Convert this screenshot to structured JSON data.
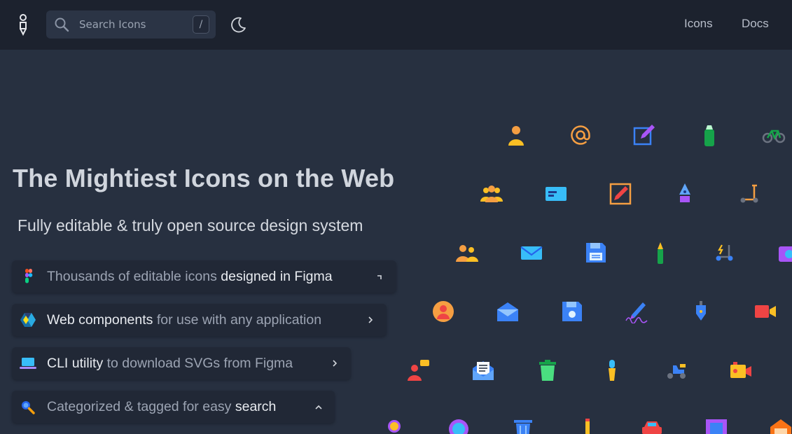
{
  "nav": {
    "search_placeholder": "Search Icons",
    "search_shortcut": "/",
    "links": [
      "Icons",
      "Docs"
    ]
  },
  "hero": {
    "title": "The Mightiest Icons on the Web",
    "subtitle": "Fully editable & truly open source design system"
  },
  "features": [
    {
      "icon": "figma-icon",
      "parts": [
        {
          "t": "Thousands of editable icons ",
          "hi": false
        },
        {
          "t": "designed in Figma",
          "hi": true
        }
      ],
      "chevron": "corner"
    },
    {
      "icon": "webcomponents-icon",
      "parts": [
        {
          "t": "Web components",
          "hi": true
        },
        {
          "t": " for use with any application",
          "hi": false
        }
      ],
      "chevron": "right"
    },
    {
      "icon": "laptop-icon",
      "parts": [
        {
          "t": "CLI utility",
          "hi": true
        },
        {
          "t": " to download SVGs from Figma",
          "hi": false
        }
      ],
      "chevron": "right"
    },
    {
      "icon": "search-icon",
      "parts": [
        {
          "t": "Categorized & tagged for easy ",
          "hi": false
        },
        {
          "t": "search",
          "hi": true
        }
      ],
      "chevron": "up"
    }
  ],
  "colors": {
    "background": "#273040",
    "navbar": "#1c222e",
    "pill": "#212836",
    "accent_blue": "#3b82f6",
    "accent_orange": "#f59e42"
  }
}
